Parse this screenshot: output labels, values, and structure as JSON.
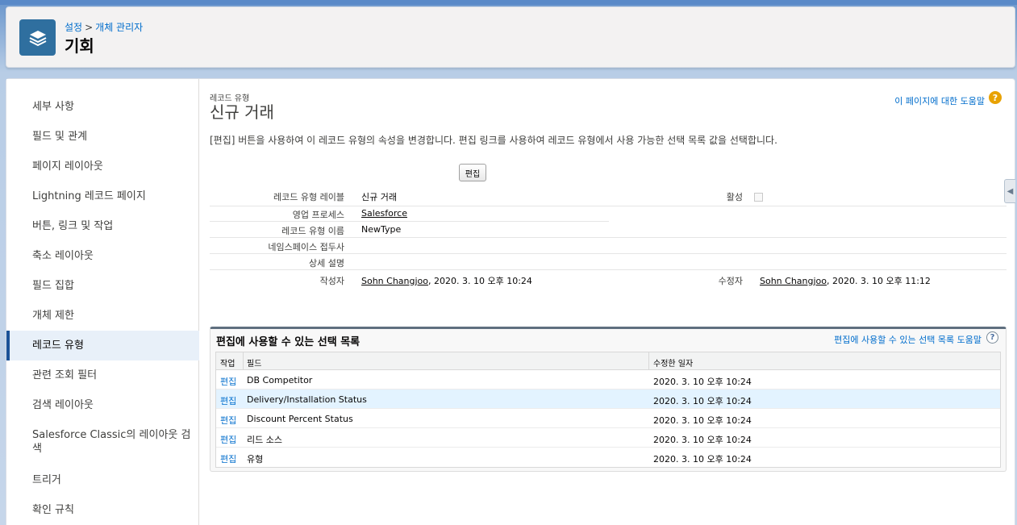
{
  "header": {
    "breadcrumb_root": "설정",
    "breadcrumb_sep": ">",
    "breadcrumb_current": "개체 관리자",
    "title": "기회",
    "icon": "layers-icon"
  },
  "sidebar": {
    "items": [
      {
        "label": "세부 사항"
      },
      {
        "label": "필드 및 관계"
      },
      {
        "label": "페이지 레이아웃"
      },
      {
        "label": "Lightning 레코드 페이지"
      },
      {
        "label": "버튼, 링크 및 작업"
      },
      {
        "label": "축소 레이아웃"
      },
      {
        "label": "필드 집합"
      },
      {
        "label": "개체 제한"
      },
      {
        "label": "레코드 유형",
        "active": true
      },
      {
        "label": "관련 조회 필터"
      },
      {
        "label": "검색 레이아웃"
      },
      {
        "label": "Salesforce Classic의 레이아웃 검색"
      },
      {
        "label": "트리거"
      },
      {
        "label": "확인 규칙"
      }
    ]
  },
  "record": {
    "type_label": "레코드 유형",
    "name": "신규 거래",
    "help_link": "이 페이지에 대한 도움말",
    "description": "[편집] 버튼을 사용하여 이 레코드 유형의 속성을 변경합니다. 편집 링크를 사용하여 레코드 유형에서 사용 가능한 선택 목록 값을 선택합니다.",
    "edit_button": "편집",
    "fields": {
      "label_label": "레코드 유형 레이블",
      "label_value": "신규 거래",
      "active_label": "활성",
      "process_label": "영업 프로세스",
      "process_value": "Salesforce",
      "api_label": "레코드 유형 이름",
      "api_value": "NewType",
      "ns_label": "네임스페이스 접두사",
      "desc_label": "상세 설명",
      "created_label": "작성자",
      "created_user": "Sohn Changjoo",
      "created_date": ", 2020. 3. 10 오후 10:24",
      "modified_label": "수정자",
      "modified_user": "Sohn Changjoo",
      "modified_date": ", 2020. 3. 10 오후 11:12"
    }
  },
  "picklists": {
    "title": "편집에 사용할 수 있는 선택 목록",
    "help_link": "편집에 사용할 수 있는 선택 목록 도움말",
    "columns": {
      "action": "작업",
      "field": "필드",
      "modified": "수정한 일자"
    },
    "rows": [
      {
        "action": "편집",
        "field": "DB Competitor",
        "modified": "2020. 3. 10 오후 10:24"
      },
      {
        "action": "편집",
        "field": "Delivery/Installation Status",
        "modified": "2020. 3. 10 오후 10:24"
      },
      {
        "action": "편집",
        "field": "Discount Percent Status",
        "modified": "2020. 3. 10 오후 10:24"
      },
      {
        "action": "편집",
        "field": "리드 소스",
        "modified": "2020. 3. 10 오후 10:24"
      },
      {
        "action": "편집",
        "field": "유형",
        "modified": "2020. 3. 10 오후 10:24"
      }
    ]
  }
}
